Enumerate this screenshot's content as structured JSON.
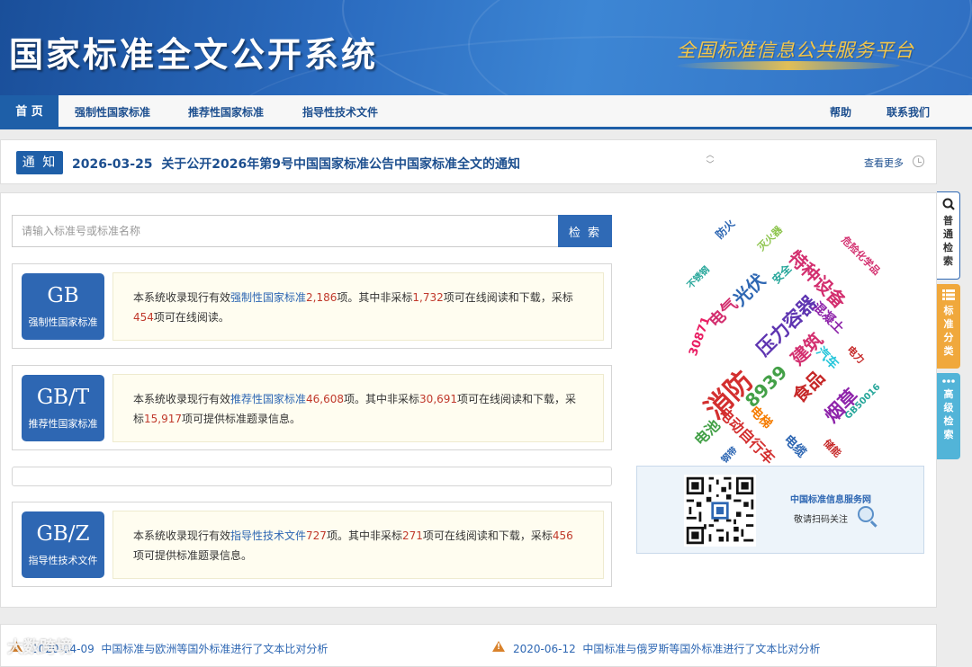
{
  "header": {
    "title": "国家标准全文公开系统",
    "slogan": "全国标准信息公共服务平台"
  },
  "nav": {
    "home": "首 页",
    "mandatory": "强制性国家标准",
    "recommended": "推荐性国家标准",
    "guidance": "指导性技术文件",
    "help": "帮助",
    "contact": "联系我们"
  },
  "notice": {
    "tag": "通 知",
    "date": "2026-03-25",
    "text": "关于公开2026年第9号中国国家标准公告中国家标准全文的通知",
    "more": "查看更多",
    "arrow_up": "︿",
    "arrow_down": "﹀"
  },
  "search": {
    "placeholder": "请输入标准号或标准名称",
    "button": "检 索"
  },
  "cards": [
    {
      "code": "GB",
      "sub": "强制性国家标准",
      "t1": "本系统收录现行有效",
      "kind": "强制性国家标准",
      "total": "2,186",
      "t2": "项。其中非采标",
      "nonadopt": "1,732",
      "t3": "项可在线阅读和下载，采标",
      "adopt": "454",
      "t4": "项可在线阅读。"
    },
    {
      "code": "GB/T",
      "sub": "推荐性国家标准",
      "t1": "本系统收录现行有效",
      "kind": "推荐性国家标准",
      "total": "46,608",
      "t2": "项。其中非采标",
      "nonadopt": "30,691",
      "t3": "项可在线阅读和下载，采标",
      "adopt": "15,917",
      "t4": "项可提供标准题录信息。"
    },
    {
      "code": "GB/Z",
      "sub": "指导性技术文件",
      "t1": "本系统收录现行有效",
      "kind": "指导性技术文件",
      "total": "727",
      "t2": "项。其中非采标",
      "nonadopt": "271",
      "t3": "项可在线阅读和下载，采标",
      "adopt": "456",
      "t4": "项可提供标准题录信息。"
    }
  ],
  "word_cloud": [
    {
      "text": "防火",
      "color": "#2e67b3"
    },
    {
      "text": "灭火器",
      "color": "#8bc34a"
    },
    {
      "text": "特种设备",
      "color": "#d32f6f"
    },
    {
      "text": "危险化学品",
      "color": "#d32f6f"
    },
    {
      "text": "不锈钢",
      "color": "#26a69a"
    },
    {
      "text": "光伏",
      "color": "#2e67b3"
    },
    {
      "text": "安全",
      "color": "#26a69a"
    },
    {
      "text": "电气",
      "color": "#d32f6f"
    },
    {
      "text": "压力容器",
      "color": "#5e35b1"
    },
    {
      "text": "混凝土",
      "color": "#8e24aa"
    },
    {
      "text": "30871",
      "color": "#e91e63"
    },
    {
      "text": "建筑",
      "color": "#d32f6f"
    },
    {
      "text": "电力",
      "color": "#c62828"
    },
    {
      "text": "消防",
      "color": "#d32f2f"
    },
    {
      "text": "汽车",
      "color": "#26c6da"
    },
    {
      "text": "8939",
      "color": "#43a047"
    },
    {
      "text": "食品",
      "color": "#c62828"
    },
    {
      "text": "烟草",
      "color": "#8e24aa"
    },
    {
      "text": "GB50016",
      "color": "#26a69a"
    },
    {
      "text": "电梯",
      "color": "#f57c00"
    },
    {
      "text": "电池",
      "color": "#43a047"
    },
    {
      "text": "电动自行车",
      "color": "#d32f2f"
    },
    {
      "text": "电缆",
      "color": "#2e67b3"
    },
    {
      "text": "钢带",
      "color": "#2e67b3"
    },
    {
      "text": "储能",
      "color": "#c62828"
    }
  ],
  "qr": {
    "title": "中国标准信息服务网",
    "subtitle": "敬请扫码关注"
  },
  "side_tabs": {
    "basic": [
      "普",
      "通",
      "检",
      "索"
    ],
    "classify": [
      "标",
      "准",
      "分",
      "类"
    ],
    "advanced": [
      "高",
      "级",
      "检",
      "索"
    ]
  },
  "news": [
    {
      "date": "2020-04-09",
      "text": "中国标准与欧洲等国外标准进行了文本比对分析"
    },
    {
      "date": "2020-06-12",
      "text": "中国标准与俄罗斯等国外标准进行了文本比对分析"
    }
  ],
  "watermark": "大数跨境"
}
